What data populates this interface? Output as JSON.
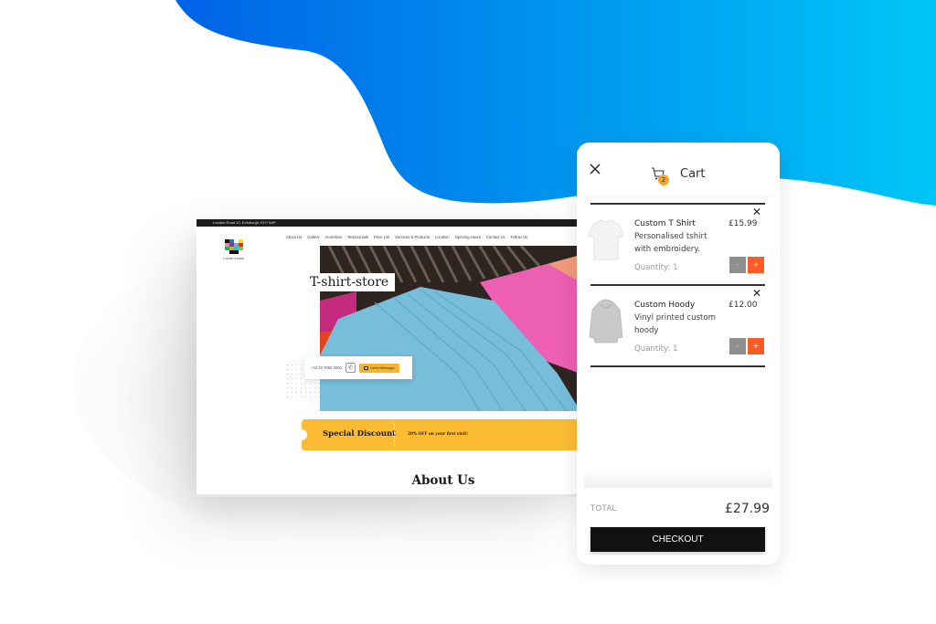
{
  "theme": {
    "gradient_start": "#0062e6",
    "gradient_end": "#00c6f7",
    "accent_yellow": "#fbbc34",
    "accent_orange": "#fb5b24",
    "checkout_bg": "#111111"
  },
  "website": {
    "topbar_address": "London Road 10, Edinburgh, EH7 5AP",
    "logo_text": "T-SHIRT STORE",
    "nav": [
      "About Us",
      "Gallery",
      "Amenities",
      "Testimonials",
      "Price List",
      "Services & Products",
      "Location",
      "Opening Hours",
      "Contact Us",
      "Follow Us"
    ],
    "hero_title": "T-shirt-store",
    "contact": {
      "phone": "+44 20 7666 0000",
      "whatsapp_icon": "whatsapp-icon",
      "send_message_label": "Send Message"
    },
    "discount": {
      "label": "Special Discount",
      "offer": "20% OFF on your first visit!"
    },
    "section_heading": "About Us"
  },
  "cart": {
    "title": "Cart",
    "badge_count": "2",
    "items": [
      {
        "name": "Custom T Shirt",
        "price": "£15.99",
        "description": "Personalised tshirt with embroidery.",
        "quantity": "Quantity: 1",
        "minus": "-",
        "plus": "+"
      },
      {
        "name": "Custom Hoody",
        "price": "£12.00",
        "description": "Vinyl printed custom hoody",
        "quantity": "Quantity: 1",
        "minus": "-",
        "plus": "+"
      }
    ],
    "total_label": "TOTAL",
    "total_value": "£27.99",
    "checkout_label": "CHECKOUT"
  }
}
